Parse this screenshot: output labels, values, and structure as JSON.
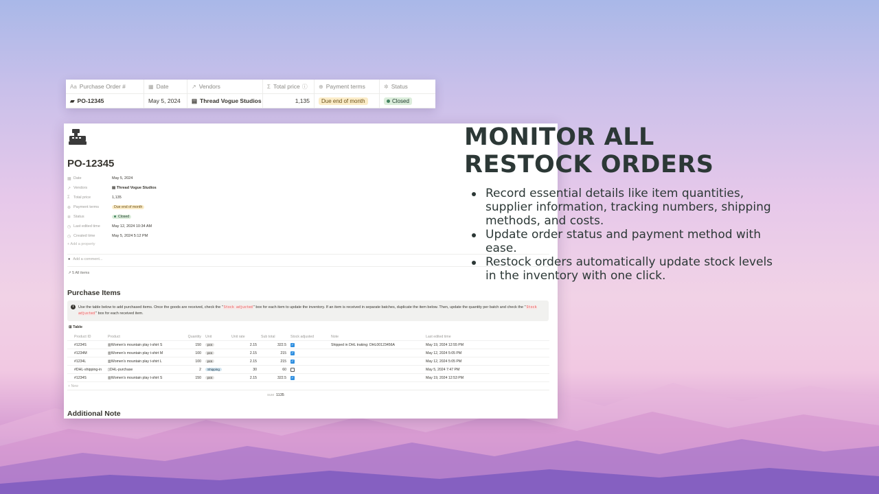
{
  "strip": {
    "headers": [
      {
        "icon": "Aa",
        "label": "Purchase Order #"
      },
      {
        "icon": "▦",
        "label": "Date"
      },
      {
        "icon": "↗",
        "label": "Vendors"
      },
      {
        "icon": "Σ",
        "label": "Total price"
      },
      {
        "icon": "⊕",
        "label": "Payment terms"
      },
      {
        "icon": "✲",
        "label": "Status"
      }
    ],
    "row": {
      "po": "PO-12345",
      "date": "May 5, 2024",
      "vendor": "Thread Vogue Studios",
      "total": "1,135",
      "terms": "Due end of month",
      "status": "Closed"
    }
  },
  "page": {
    "title": "PO-12345",
    "props": [
      {
        "icon": "▦",
        "name": "Date",
        "value": "May 5, 2024"
      },
      {
        "icon": "↗",
        "name": "Vendors",
        "value": "Thread Vogue Studios"
      },
      {
        "icon": "Σ",
        "name": "Total price",
        "value": "1,135"
      },
      {
        "icon": "⊕",
        "name": "Payment terms",
        "value": "Due end of month"
      },
      {
        "icon": "✲",
        "name": "Status",
        "value": "Closed"
      },
      {
        "icon": "◷",
        "name": "Last edited time",
        "value": "May 12, 2024 10:34 AM"
      },
      {
        "icon": "◷",
        "name": "Created time",
        "value": "May 5, 2024 5:12 PM"
      }
    ],
    "add_property": "+ Add a property",
    "add_comment": "Add a comment...",
    "all_items": "↗ 5 All items",
    "purchase_items_heading": "Purchase Items",
    "callout": {
      "part1": "Use the table below to add purchased items. Once the goods are received, check the \"",
      "code": "Stock adjusted",
      "part2": "\" box for each item to update the inventory. If an item is received in separate batches, duplicate the item below. Then, update the quantity per batch and check the \"",
      "part3": "\" box for each received item."
    },
    "table_label": "Table",
    "table_headers": [
      "Product ID",
      "Product",
      "Quantity",
      "Unit",
      "Unit rate",
      "Sub total",
      "Stock adjusted",
      "Note",
      "Last edited time"
    ],
    "rows": [
      {
        "id": "#1234S",
        "product": "Women's mountain play t-shirt S",
        "qty": "150",
        "unit": "pcs",
        "rate": "2.15",
        "sub": "322.5",
        "adjusted": true,
        "note": "Shipped in DHL traking: DHL00123456A",
        "edited": "May 19, 2024 12:55 PM"
      },
      {
        "id": "#1234M",
        "product": "Women's mountain play t-shirt M",
        "qty": "100",
        "unit": "pcs",
        "rate": "2.15",
        "sub": "215",
        "adjusted": true,
        "note": "",
        "edited": "May 12, 2024 5:05 PM"
      },
      {
        "id": "#1234L",
        "product": "Women's mountain play t-shirt L",
        "qty": "100",
        "unit": "pcs",
        "rate": "2.15",
        "sub": "215",
        "adjusted": true,
        "note": "",
        "edited": "May 12, 2024 5:05 PM"
      },
      {
        "id": "#DHL-shipping-in",
        "product": "DHL-purchase",
        "qty": "2",
        "unit": "Shipping",
        "rate": "30",
        "sub": "60",
        "adjusted": false,
        "note": "",
        "edited": "May 5, 2024 7:47 PM"
      },
      {
        "id": "#1234S",
        "product": "Women's mountain play t-shirt S",
        "qty": "150",
        "unit": "pcs",
        "rate": "2.15",
        "sub": "322.5",
        "adjusted": true,
        "note": "",
        "edited": "May 19, 2024 12:53 PM"
      }
    ],
    "new_row": "+ New",
    "sum_label": "SUM",
    "sum_value": "1135",
    "additional_note_heading": "Additional Note"
  },
  "headline": {
    "line1": "MONITOR ALL",
    "line2": "RESTOCK ORDERS"
  },
  "bullets": [
    "Record essential details like item quantities, supplier information, tracking numbers, shipping methods, and costs.",
    "Update order status and payment method with ease.",
    "Restock orders automatically update stock levels in the inventory with one click."
  ],
  "colors": {
    "headline": "#2c3836",
    "check_blue": "#2f8fe0",
    "status_green": "#448361"
  }
}
